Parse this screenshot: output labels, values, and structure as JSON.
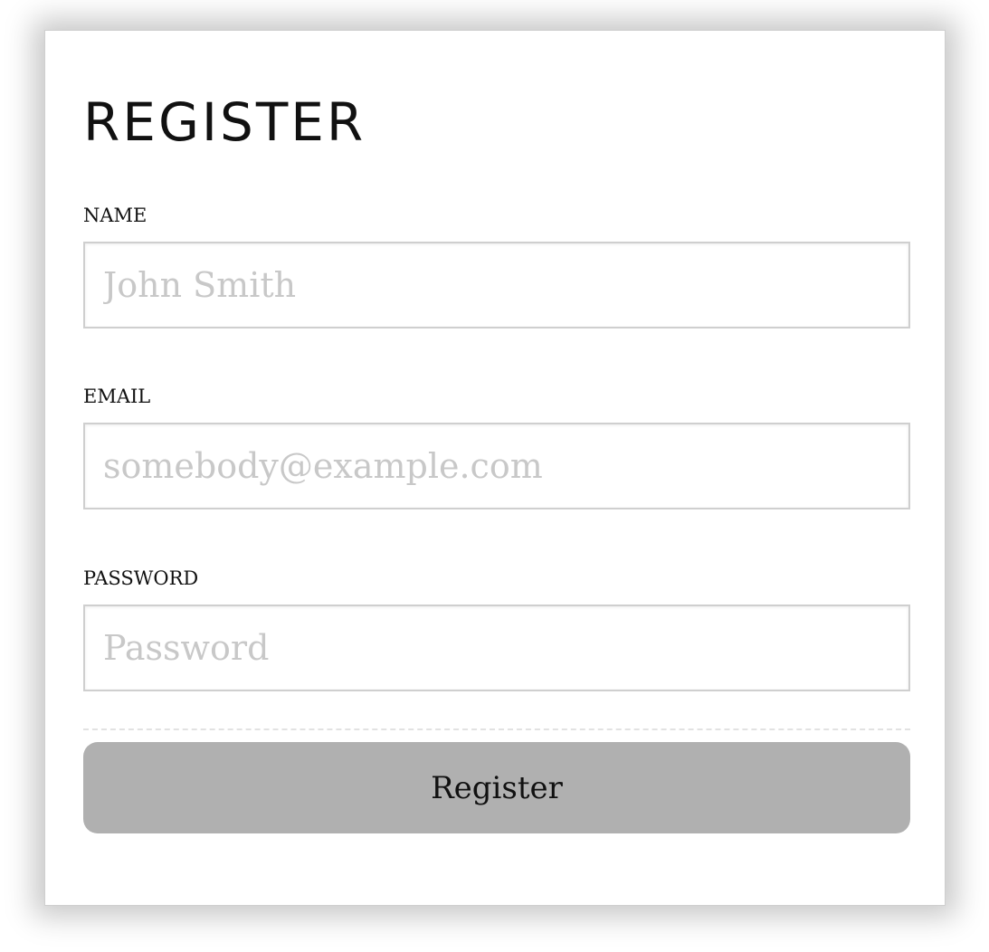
{
  "form": {
    "title": "REGISTER",
    "fields": [
      {
        "label": "NAME",
        "placeholder": "John Smith",
        "value": ""
      },
      {
        "label": "EMAIL",
        "placeholder": "somebody@example.com",
        "value": ""
      },
      {
        "label": "PASSWORD",
        "placeholder": "Password",
        "value": ""
      }
    ],
    "submit_label": "Register"
  },
  "colors": {
    "button_background": "#b0b0b0",
    "input_border": "#cfcfcf",
    "placeholder_text": "#c8c8c8",
    "text": "#111111"
  }
}
